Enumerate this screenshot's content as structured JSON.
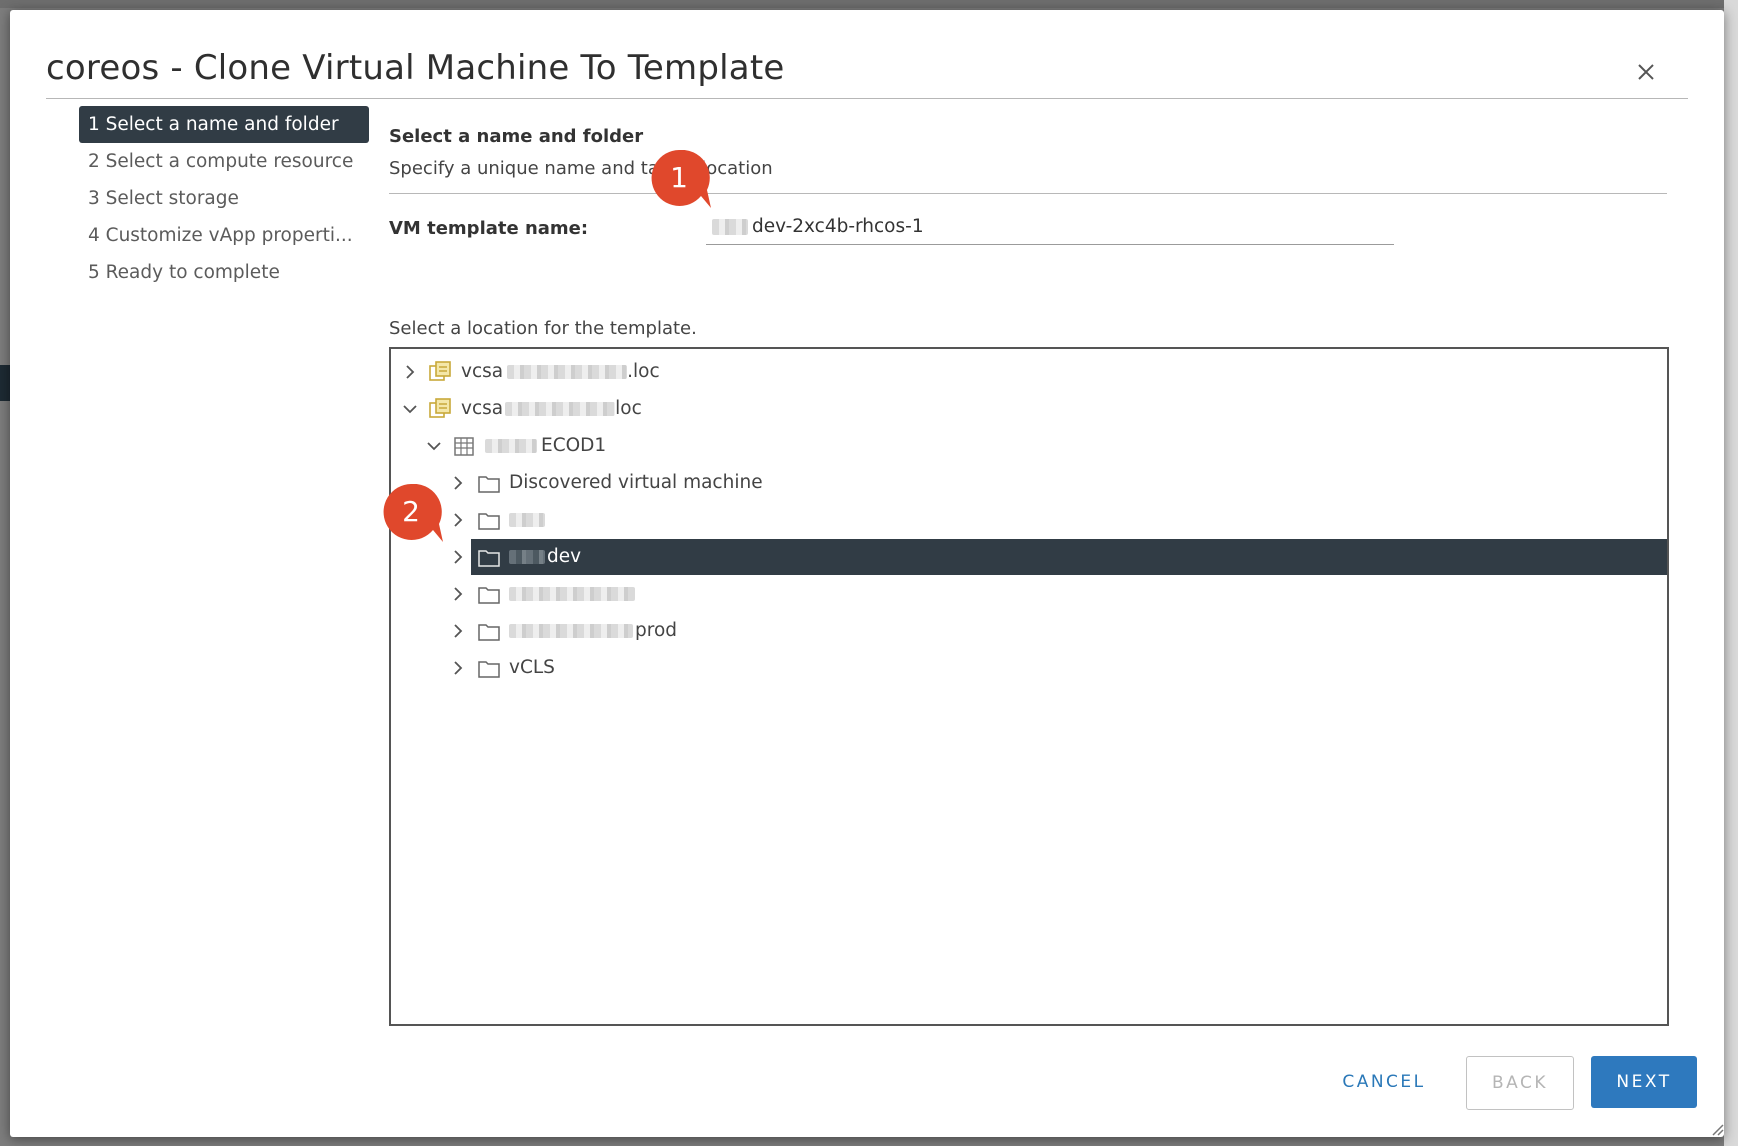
{
  "dialog": {
    "title": "coreos - Clone Virtual Machine To Template",
    "close_icon": "close-icon"
  },
  "steps": [
    {
      "label": "1 Select a name and folder",
      "active": true
    },
    {
      "label": "2 Select a compute resource",
      "active": false
    },
    {
      "label": "3 Select storage",
      "active": false
    },
    {
      "label": "4 Customize vApp properti...",
      "active": false
    },
    {
      "label": "5 Ready to complete",
      "active": false
    }
  ],
  "section": {
    "title": "Select a name and folder",
    "subtitle": "Specify a unique name and target location"
  },
  "vm_name": {
    "label": "VM template name:",
    "value": "dev-2xc4b-rhcos-1"
  },
  "location": {
    "label": "Select a location for the template."
  },
  "tree": [
    {
      "label": "vcsa",
      "suffix": ".loc",
      "icon": "vcenter-icon",
      "expanded": false
    },
    {
      "label": "vcsa",
      "suffix": "loc",
      "icon": "vcenter-icon",
      "expanded": true
    },
    {
      "label": "ECOD1",
      "icon": "datacenter-icon",
      "expanded": true
    },
    {
      "label": "Discovered virtual machine",
      "icon": "folder-icon",
      "expanded": false
    },
    {
      "label": "",
      "icon": "folder-icon",
      "expanded": false
    },
    {
      "label": "dev",
      "icon": "folder-icon",
      "expanded": false,
      "selected": true
    },
    {
      "label": "",
      "icon": "folder-icon",
      "expanded": false
    },
    {
      "label": "prod",
      "icon": "folder-icon",
      "expanded": false
    },
    {
      "label": "vCLS",
      "icon": "folder-icon",
      "expanded": false
    }
  ],
  "callouts": [
    "1",
    "2"
  ],
  "buttons": {
    "cancel": "CANCEL",
    "back": "BACK",
    "next": "NEXT"
  },
  "colors": {
    "selected_bg": "#313c45",
    "primary_button": "#2e79be",
    "callout": "#e0482c"
  }
}
